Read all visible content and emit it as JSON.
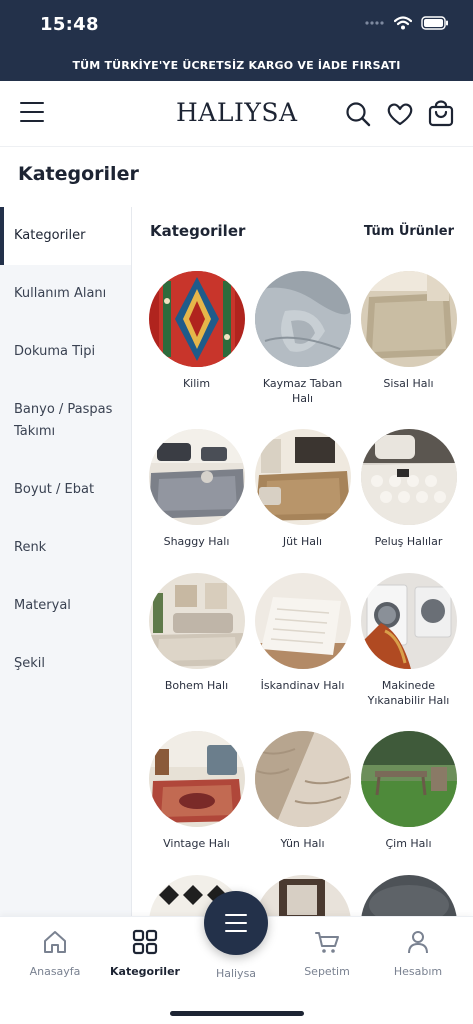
{
  "status": {
    "time": "15:48"
  },
  "banner": {
    "text": "TÜM TÜRKİYE'YE ÜCRETSİZ KARGO VE İADE FIRSATI"
  },
  "header": {
    "logo": "HALIYSA"
  },
  "page": {
    "title": "Kategoriler"
  },
  "sidebar": {
    "items": [
      {
        "label": "Kategoriler"
      },
      {
        "label": "Kullanım Alanı"
      },
      {
        "label": "Dokuma Tipi"
      },
      {
        "label": "Banyo / Paspas Takımı"
      },
      {
        "label": "Boyut / Ebat"
      },
      {
        "label": "Renk"
      },
      {
        "label": "Materyal"
      },
      {
        "label": "Şekil"
      }
    ]
  },
  "content": {
    "title": "Kategoriler",
    "all_label": "Tüm Ürünler",
    "categories": [
      {
        "label": "Kilim"
      },
      {
        "label": "Kaymaz Taban Halı"
      },
      {
        "label": "Sisal Halı"
      },
      {
        "label": "Shaggy Halı"
      },
      {
        "label": "Jüt Halı"
      },
      {
        "label": "Peluş Halılar"
      },
      {
        "label": "Bohem Halı"
      },
      {
        "label": "İskandinav Halı"
      },
      {
        "label": "Makinede Yıkanabilir Halı"
      },
      {
        "label": "Vintage Halı"
      },
      {
        "label": "Yün Halı"
      },
      {
        "label": "Çim Halı"
      }
    ]
  },
  "bottom_nav": {
    "items": [
      {
        "label": "Anasayfa",
        "icon": "home-icon"
      },
      {
        "label": "Kategoriler",
        "icon": "grid-icon"
      },
      {
        "label": "Haliysa",
        "icon": "menu-icon"
      },
      {
        "label": "Sepetim",
        "icon": "cart-icon"
      },
      {
        "label": "Hesabım",
        "icon": "user-icon"
      }
    ]
  },
  "colors": {
    "brand": "#23314a",
    "sidebar_bg": "#f4f6f9",
    "text": "#1d2433",
    "muted": "#7a8291"
  }
}
